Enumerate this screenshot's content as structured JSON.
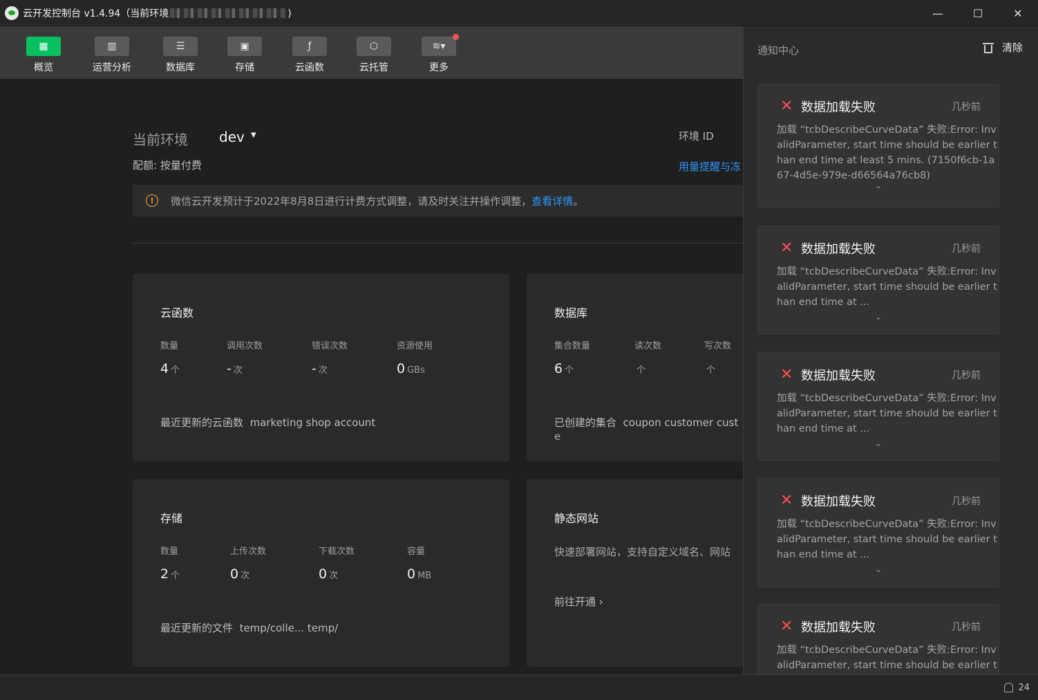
{
  "window": {
    "title_prefix": "云开发控制台 v1.4.94（当前环境",
    "title_suffix": ")",
    "minimize_glyph": "—",
    "maximize_glyph": "☐",
    "close_glyph": "✕"
  },
  "toolbar": {
    "items": [
      {
        "label": "概览",
        "icon": "grid-icon",
        "glyph": "▦",
        "active": true
      },
      {
        "label": "运营分析",
        "icon": "bar-chart-icon",
        "glyph": "▥"
      },
      {
        "label": "数据库",
        "icon": "database-icon",
        "glyph": "☰"
      },
      {
        "label": "存储",
        "icon": "save-icon",
        "glyph": "▣"
      },
      {
        "label": "云函数",
        "icon": "function-icon",
        "glyph": "ƒ"
      },
      {
        "label": "云托管",
        "icon": "cube-icon",
        "glyph": "⬡"
      },
      {
        "label": "更多",
        "icon": "layers-icon",
        "glyph": "≋▾",
        "badge": true
      }
    ]
  },
  "env": {
    "label": "当前环境",
    "value": "dev",
    "caret": "▼",
    "id_label": "环境 ID",
    "quota": "配额: 按量付费",
    "usage_link": "用量提醒与冻"
  },
  "notice": {
    "icon": "!",
    "text": "微信云开发预计于2022年8月8日进行计费方式调整，请及时关注并操作调整，",
    "link": "查看详情",
    "tail": "。"
  },
  "cards": {
    "functions": {
      "title": "云函数",
      "stats": [
        {
          "label": "数量",
          "value": "4",
          "unit": "个"
        },
        {
          "label": "调用次数",
          "value": "-",
          "unit": "次"
        },
        {
          "label": "错误次数",
          "value": "-",
          "unit": "次"
        },
        {
          "label": "资源使用",
          "value": "0",
          "unit": "GBs"
        }
      ],
      "recent_label": "最近更新的云函数",
      "recent_value": "marketing  shop  account"
    },
    "database": {
      "title": "数据库",
      "stats": [
        {
          "label": "集合数量",
          "value": "6",
          "unit": "个"
        },
        {
          "label": "读次数",
          "value": "",
          "unit": "个"
        },
        {
          "label": "写次数",
          "value": "",
          "unit": "个"
        }
      ],
      "recent_label": "已创建的集合",
      "recent_value": "coupon  customer  cust",
      "recent_wrap": "e"
    },
    "storage": {
      "title": "存储",
      "stats": [
        {
          "label": "数量",
          "value": "2",
          "unit": "个"
        },
        {
          "label": "上传次数",
          "value": "0",
          "unit": "次"
        },
        {
          "label": "下载次数",
          "value": "0",
          "unit": "次"
        },
        {
          "label": "容量",
          "value": "0",
          "unit": "MB"
        }
      ],
      "recent_label": "最近更新的文件",
      "recent_value": "temp/colle...  temp/"
    },
    "static": {
      "title": "静态网站",
      "desc": "快速部署网站，支持自定义域名、网站",
      "action": "前往开通",
      "action_icon": "›"
    }
  },
  "notifications": {
    "header": "通知中心",
    "clear": "清除",
    "items": [
      {
        "title": "数据加载失败",
        "time": "几秒前",
        "body": "加载 “tcbDescribeCurveData” 失败:Error: InvalidParameter, start time should be earlier than end time at least 5 mins. (7150f6cb-1a67-4d5e-979e-d66564a76cb8)",
        "chevron": "⌃"
      },
      {
        "title": "数据加载失败",
        "time": "几秒前",
        "body": "加载 “tcbDescribeCurveData” 失败:Error: InvalidParameter, start time should be earlier than end time at ...",
        "chevron": "⌄"
      },
      {
        "title": "数据加载失败",
        "time": "几秒前",
        "body": "加载 “tcbDescribeCurveData” 失败:Error: InvalidParameter, start time should be earlier than end time at ...",
        "chevron": "⌄"
      },
      {
        "title": "数据加载失败",
        "time": "几秒前",
        "body": "加载 “tcbDescribeCurveData” 失败:Error: InvalidParameter, start time should be earlier than end time at ...",
        "chevron": "⌄"
      },
      {
        "title": "数据加载失败",
        "time": "几秒前",
        "body": "加载 “tcbDescribeCurveData” 失败:Error: InvalidParameter, start time should be earlier t",
        "chevron": ""
      }
    ],
    "close_glyph": "✕"
  },
  "statusbar": {
    "bell_count": "24"
  },
  "colors": {
    "accent": "#07c160",
    "link": "#2f94f5",
    "error": "#fa5151",
    "warning": "#fa9d3b"
  }
}
